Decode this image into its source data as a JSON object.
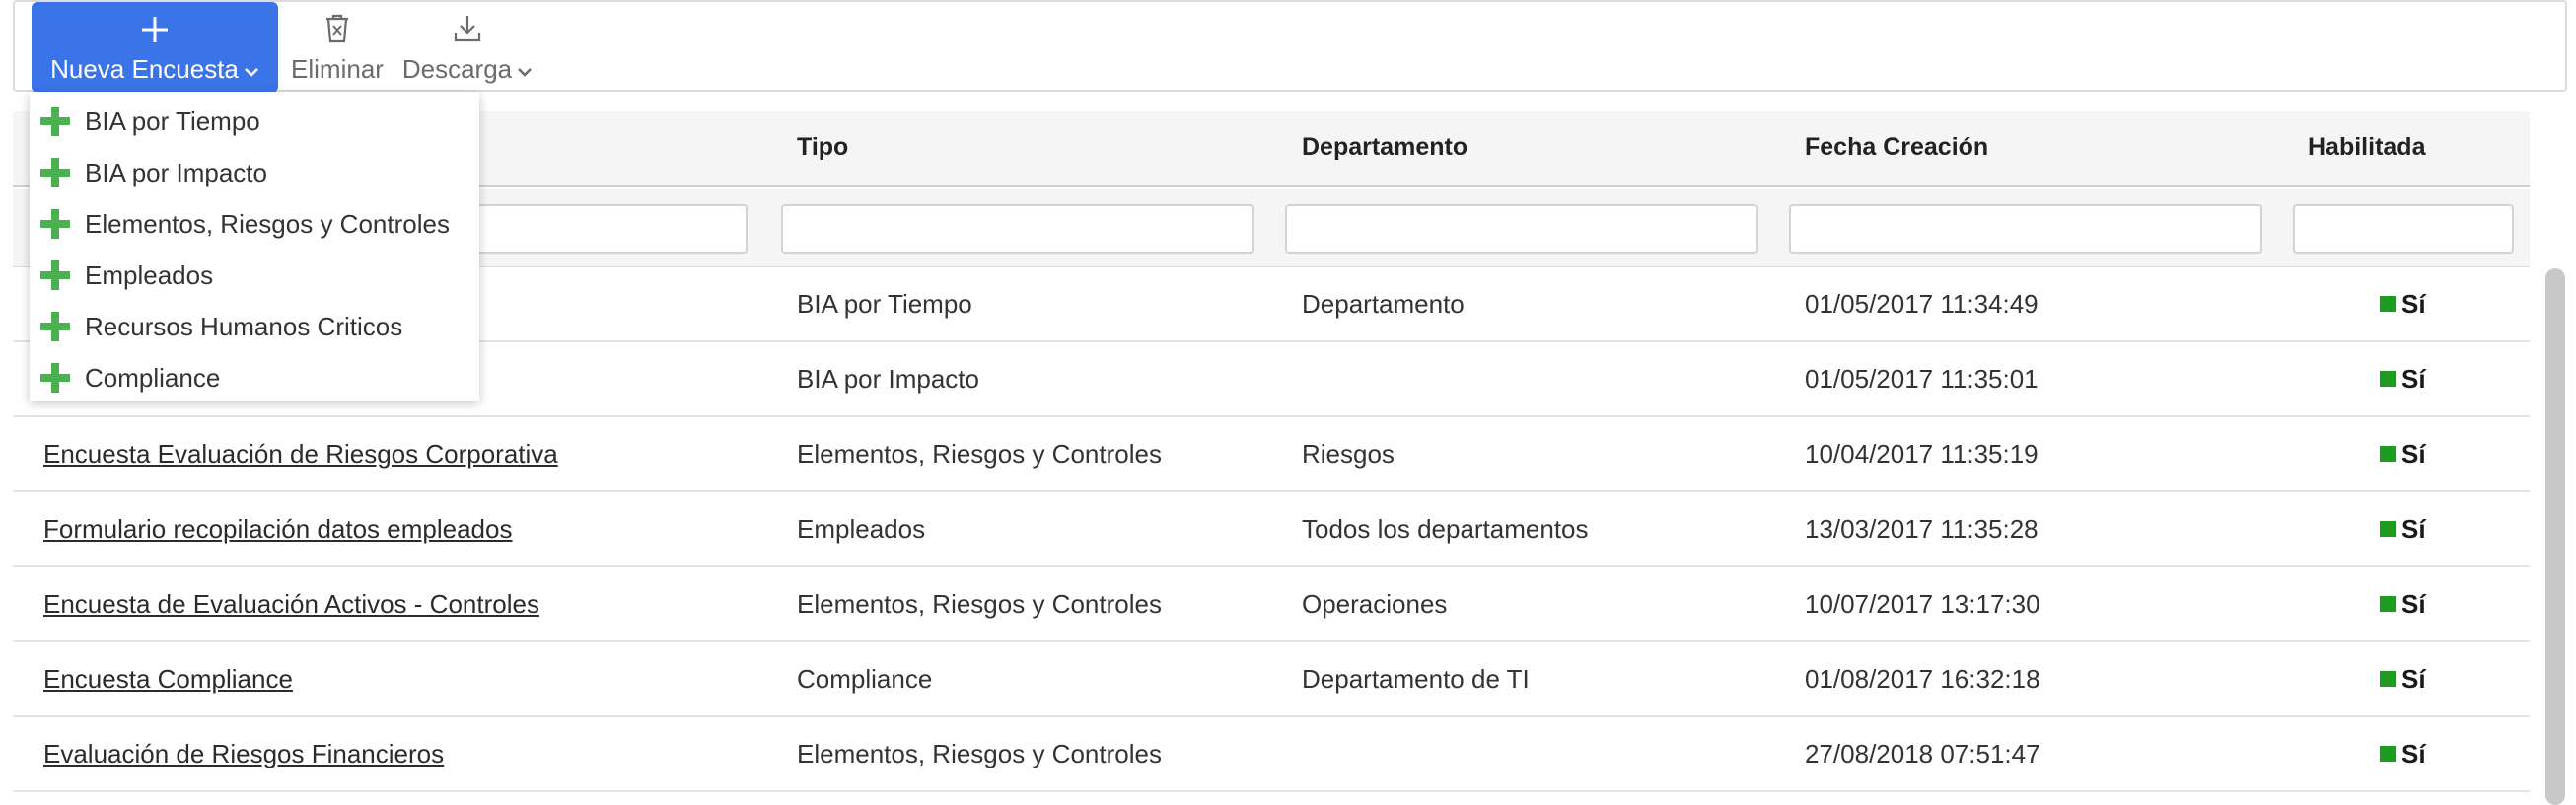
{
  "toolbar": {
    "new_label": "Nueva Encuesta",
    "delete_label": "Eliminar",
    "download_label": "Descarga"
  },
  "dropdown": {
    "items": [
      "BIA por Tiempo",
      "BIA por Impacto",
      "Elementos, Riesgos y Controles",
      "Empleados",
      "Recursos Humanos Criticos",
      "Compliance"
    ]
  },
  "table": {
    "headers": {
      "tipo": "Tipo",
      "departamento": "Departamento",
      "fecha": "Fecha Creación",
      "habilitada": "Habilitada"
    },
    "rows": [
      {
        "nombre": "",
        "tipo": "BIA por Tiempo",
        "departamento": "Departamento",
        "fecha": "01/05/2017 11:34:49",
        "habilitada": "Sí"
      },
      {
        "nombre": "",
        "tipo": "BIA por Impacto",
        "departamento": "",
        "fecha": "01/05/2017 11:35:01",
        "habilitada": "Sí"
      },
      {
        "nombre": "Encuesta Evaluación de Riesgos Corporativa",
        "tipo": "Elementos, Riesgos y Controles",
        "departamento": "Riesgos",
        "fecha": "10/04/2017 11:35:19",
        "habilitada": "Sí"
      },
      {
        "nombre": "Formulario recopilación datos empleados",
        "tipo": "Empleados",
        "departamento": "Todos los departamentos",
        "fecha": "13/03/2017 11:35:28",
        "habilitada": "Sí"
      },
      {
        "nombre": "Encuesta de Evaluación Activos - Controles",
        "tipo": "Elementos, Riesgos y Controles",
        "departamento": "Operaciones",
        "fecha": "10/07/2017 13:17:30",
        "habilitada": "Sí"
      },
      {
        "nombre": "Encuesta Compliance",
        "tipo": "Compliance",
        "departamento": "Departamento de TI",
        "fecha": "01/08/2017 16:32:18",
        "habilitada": "Sí"
      },
      {
        "nombre": "Evaluación de Riesgos Financieros",
        "tipo": "Elementos, Riesgos y Controles",
        "departamento": "",
        "fecha": "27/08/2018 07:51:47",
        "habilitada": "Sí"
      }
    ]
  },
  "colors": {
    "primary": "#3b73e8",
    "enabled": "#1f9b1f",
    "menu_plus": "#4caf50"
  },
  "icons": {
    "new": "plus-icon",
    "delete": "trash-icon",
    "download": "download-icon",
    "menu_item": "green-plus-icon",
    "enabled": "green-square-icon"
  }
}
